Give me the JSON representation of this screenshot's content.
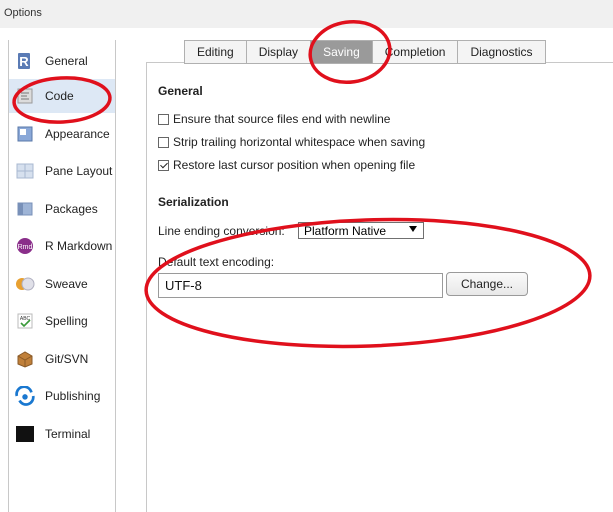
{
  "window": {
    "title": "Options"
  },
  "sidebar": {
    "items": [
      {
        "label": "General",
        "icon": "r-logo-icon"
      },
      {
        "label": "Code",
        "icon": "code-icon",
        "selected": true
      },
      {
        "label": "Appearance",
        "icon": "appearance-icon"
      },
      {
        "label": "Pane Layout",
        "icon": "pane-layout-icon"
      },
      {
        "label": "Packages",
        "icon": "packages-icon"
      },
      {
        "label": "R Markdown",
        "icon": "rmd-icon",
        "icon_text": "Rmd"
      },
      {
        "label": "Sweave",
        "icon": "sweave-icon"
      },
      {
        "label": "Spelling",
        "icon": "spelling-icon",
        "icon_text": "ABC"
      },
      {
        "label": "Git/SVN",
        "icon": "git-icon"
      },
      {
        "label": "Publishing",
        "icon": "publishing-icon"
      },
      {
        "label": "Terminal",
        "icon": "terminal-icon"
      }
    ]
  },
  "tabs": [
    {
      "label": "Editing"
    },
    {
      "label": "Display"
    },
    {
      "label": "Saving",
      "active": true
    },
    {
      "label": "Completion"
    },
    {
      "label": "Diagnostics"
    }
  ],
  "general": {
    "title": "General",
    "options": [
      {
        "label": "Ensure that source files end with newline",
        "checked": false
      },
      {
        "label": "Strip trailing horizontal whitespace when saving",
        "checked": false
      },
      {
        "label": "Restore last cursor position when opening file",
        "checked": true
      }
    ]
  },
  "serialization": {
    "title": "Serialization",
    "line_ending_label": "Line ending conversion:",
    "line_ending_value": "Platform Native",
    "encoding_label": "Default text encoding:",
    "encoding_value": "UTF-8",
    "change_button": "Change..."
  },
  "colors": {
    "selected_bg": "#dde8f5",
    "active_tab_bg": "#9a9a9a",
    "annotation_red": "#e0101c"
  }
}
